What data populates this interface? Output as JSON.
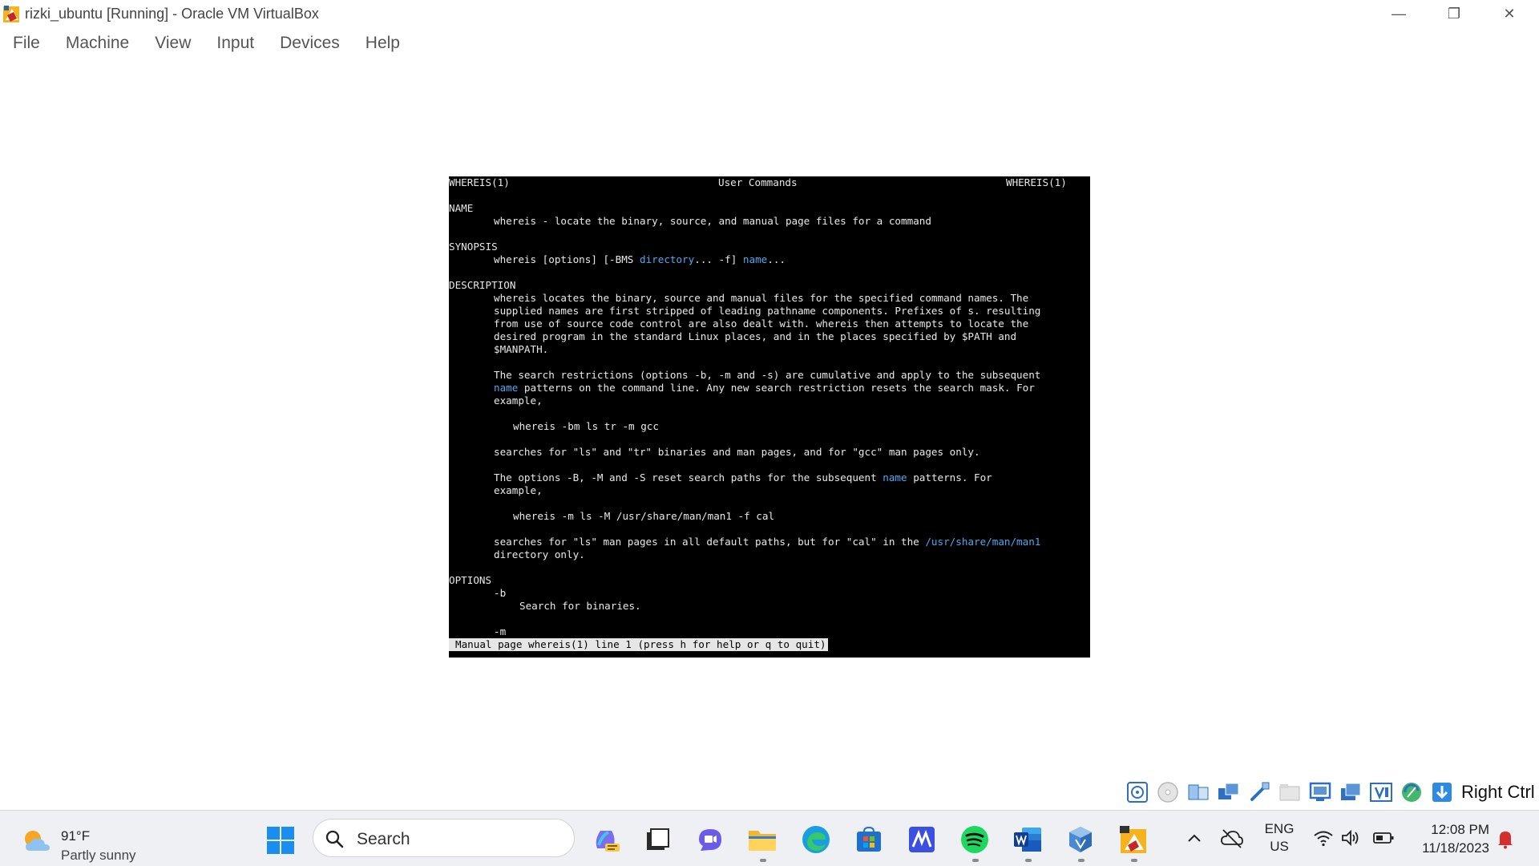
{
  "window": {
    "title": "rizki_ubuntu [Running] - Oracle VM VirtualBox",
    "controls": {
      "minimize": "—",
      "maximize": "❐",
      "close": "✕"
    }
  },
  "menu": [
    "File",
    "Machine",
    "View",
    "Input",
    "Devices",
    "Help"
  ],
  "terminal": {
    "header": {
      "left": "WHEREIS(1)",
      "center": "User Commands",
      "right": "WHEREIS(1)"
    },
    "name_heading": "NAME",
    "name_line": "whereis - locate the binary, source, and manual page files for a command",
    "synopsis_heading": "SYNOPSIS",
    "synopsis": {
      "a": "whereis [options] [-BMS ",
      "dir": "directory",
      "b": "... -f] ",
      "name": "name",
      "c": "..."
    },
    "description_heading": "DESCRIPTION",
    "desc1": [
      "whereis locates the binary, source and manual files for the specified command names. The",
      "supplied names are first stripped of leading pathname components. Prefixes of s. resulting",
      "from use of source code control are also dealt with. whereis then attempts to locate the",
      "desired program in the standard Linux places, and in the places specified by $PATH and",
      "$MANPATH."
    ],
    "desc2_l1": "The search restrictions (options -b, -m and -s) are cumulative and apply to the subsequent",
    "desc2_l2": {
      "name": "name",
      "rest": " patterns on the command line. Any new search restriction resets the search mask. For"
    },
    "desc2_l3": "example,",
    "example1": "whereis -bm ls tr -m gcc",
    "desc3": "searches for \"ls\" and \"tr\" binaries and man pages, and for \"gcc\" man pages only.",
    "desc4_l1": {
      "a": "The options -B, -M and -S reset search paths for the subsequent ",
      "name": "name",
      "b": " patterns. For"
    },
    "desc4_l2": "example,",
    "example2": "whereis -m ls -M /usr/share/man/man1 -f cal",
    "desc5_l1": {
      "a": "searches for \"ls\" man pages in all default paths, but for \"cal\" in the ",
      "path": "/usr/share/man/man1"
    },
    "desc5_l2": "directory only.",
    "options_heading": "OPTIONS",
    "opt_b": "-b",
    "opt_b_desc": "Search for binaries.",
    "opt_m": "-m",
    "status": "Manual page whereis(1) line 1 (press h for help or q to quit)"
  },
  "vm_status": {
    "host_key": "Right Ctrl"
  },
  "taskbar": {
    "weather": {
      "temp": "91°F",
      "desc": "Partly sunny"
    },
    "search_placeholder": "Search",
    "language": {
      "line1": "ENG",
      "line2": "US"
    },
    "clock": {
      "time": "12:08 PM",
      "date": "11/18/2023"
    },
    "apps": [
      "copilot",
      "task-view",
      "teams-chat",
      "file-explorer",
      "edge",
      "microsoft-store",
      "mathpix",
      "spotify",
      "word",
      "virtualbox-app",
      "virtualbox-vm"
    ]
  },
  "colors": {
    "link": "#4aa9f0",
    "terminal_bg": "#000000",
    "taskbar_bg": "#eef0f4",
    "notification": "#d32f2f"
  }
}
